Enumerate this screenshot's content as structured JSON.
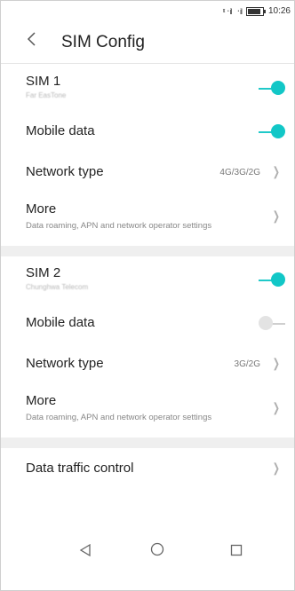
{
  "status_bar": {
    "time": "10:26",
    "sim1_signal": "᛫il",
    "sim2_signal": "᛫il"
  },
  "header": {
    "back_icon": "chevron-left-icon",
    "title": "SIM Config"
  },
  "sim1": {
    "label": "SIM 1",
    "carrier": "Far EasTone",
    "enabled": true,
    "mobile_data_label": "Mobile data",
    "mobile_data_enabled": true,
    "network_type_label": "Network type",
    "network_type_value": "4G/3G/2G",
    "more_label": "More",
    "more_sub": "Data roaming, APN and network operator settings"
  },
  "sim2": {
    "label": "SIM 2",
    "carrier": "Chunghwa Telecom",
    "enabled": true,
    "mobile_data_label": "Mobile data",
    "mobile_data_enabled": false,
    "network_type_label": "Network type",
    "network_type_value": "3G/2G",
    "more_label": "More",
    "more_sub": "Data roaming, APN and network operator settings"
  },
  "extra": {
    "data_traffic_label": "Data traffic control"
  },
  "colors": {
    "accent": "#12c7c7",
    "section_gap": "#efefef",
    "toggle_off": "#e3e3e3"
  },
  "nav": {
    "back_icon": "triangle-back-icon",
    "home_icon": "circle-home-icon",
    "recents_icon": "square-recents-icon"
  }
}
